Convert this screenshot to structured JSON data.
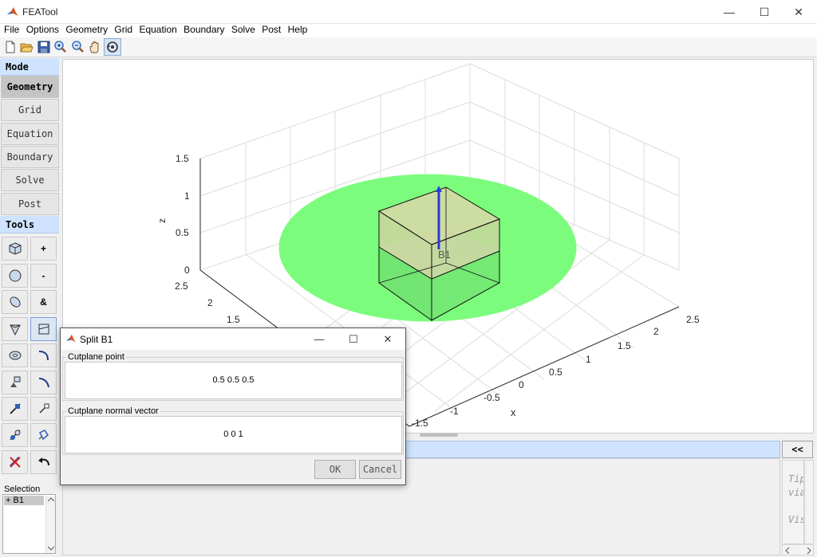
{
  "window": {
    "title": "FEATool",
    "controls": {
      "minimize": "—",
      "maximize": "☐",
      "close": "✕"
    }
  },
  "menu": [
    "File",
    "Options",
    "Geometry",
    "Grid",
    "Equation",
    "Boundary",
    "Solve",
    "Post",
    "Help"
  ],
  "toolbar": [
    "new-file-icon",
    "open-folder-icon",
    "save-icon",
    "zoom-in-icon",
    "zoom-out-icon",
    "pan-hand-icon",
    "rotate-3d-icon"
  ],
  "left_panel": {
    "mode_header": "Mode",
    "modes": [
      "Geometry",
      "Grid",
      "Equation",
      "Boundary",
      "Solve",
      "Post"
    ],
    "active_mode": "Geometry",
    "tools_header": "Tools",
    "tool_symbols": {
      "plus": "+",
      "minus": "-",
      "amp": "&"
    },
    "selection_label": "Selection",
    "selection_items": [
      "+ B1"
    ]
  },
  "plot": {
    "z_ticks": [
      "1.5",
      "1",
      "0.5",
      "0"
    ],
    "z_label": "z",
    "y_ticks": [
      "2.5",
      "2",
      "1.5"
    ],
    "x_ticks": [
      "2.5",
      "2",
      "1.5",
      "1",
      "0.5",
      "0",
      "-0.5",
      "-1",
      "-1.5"
    ],
    "x_label": "x",
    "object_label": "B1",
    "colors": {
      "disk": "#7cfc7c",
      "cube_top": "#dcd6a8",
      "arrow": "#2b3bd6"
    }
  },
  "console": {
    "expand_label": "<<",
    "tips_fragments": [
      "Tip",
      "via",
      "Vis"
    ]
  },
  "dialog": {
    "title": "Split B1",
    "cutplane_point_label": "Cutplane point",
    "cutplane_point_value": "0.5  0.5  0.5",
    "normal_vector_label": "Cutplane normal vector",
    "normal_vector_value": "0  0  1",
    "ok_label": "OK",
    "cancel_label": "Cancel"
  }
}
